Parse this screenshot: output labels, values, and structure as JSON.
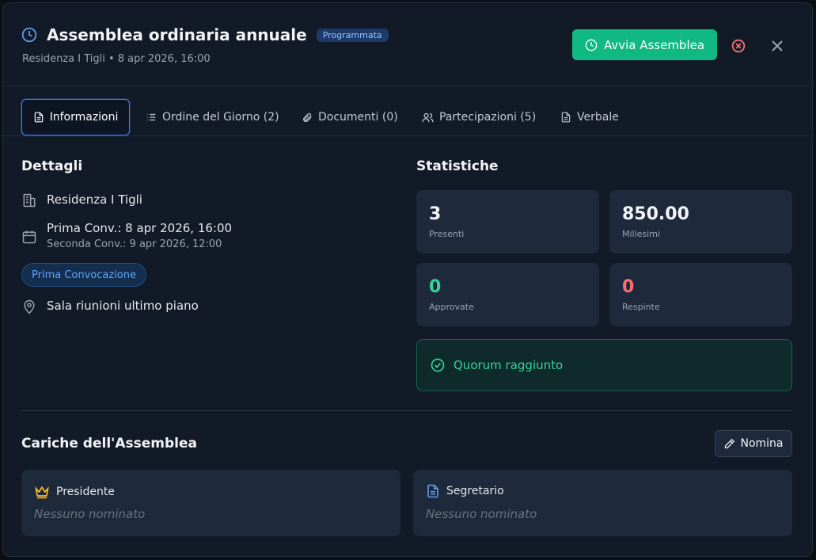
{
  "header": {
    "title": "Assemblea ordinaria annuale",
    "status_badge": "Programmata",
    "subtitle": "Residenza I Tigli • 8 apr 2026, 16:00",
    "start_button": "Avvia Assemblea"
  },
  "tabs": [
    {
      "label": "Informazioni"
    },
    {
      "label": "Ordine del Giorno (2)"
    },
    {
      "label": "Documenti (0)"
    },
    {
      "label": "Partecipazioni (5)"
    },
    {
      "label": "Verbale"
    }
  ],
  "details": {
    "title": "Dettagli",
    "building": "Residenza I Tigli",
    "first_call": "Prima Conv.: 8 apr 2026, 16:00",
    "second_call": "Seconda Conv.: 9 apr 2026, 12:00",
    "convocation_badge": "Prima Convocazione",
    "location": "Sala riunioni ultimo piano"
  },
  "stats": {
    "title": "Statistiche",
    "cards": [
      {
        "value": "3",
        "label": "Presenti",
        "color": "#f3f4f6"
      },
      {
        "value": "850.00",
        "label": "Millesimi",
        "color": "#f3f4f6"
      },
      {
        "value": "0",
        "label": "Approvate",
        "color": "#34d399"
      },
      {
        "value": "0",
        "label": "Respinte",
        "color": "#f87171"
      }
    ],
    "quorum": "Quorum raggiunto"
  },
  "roles": {
    "title": "Cariche dell'Assemblea",
    "nominate_button": "Nomina",
    "president": {
      "label": "Presidente",
      "value": "Nessuno nominato"
    },
    "secretary": {
      "label": "Segretario",
      "value": "Nessuno nominato"
    }
  },
  "colors": {
    "accent_green": "#10b981",
    "accent_blue": "#3b82f6",
    "danger": "#f87171"
  }
}
